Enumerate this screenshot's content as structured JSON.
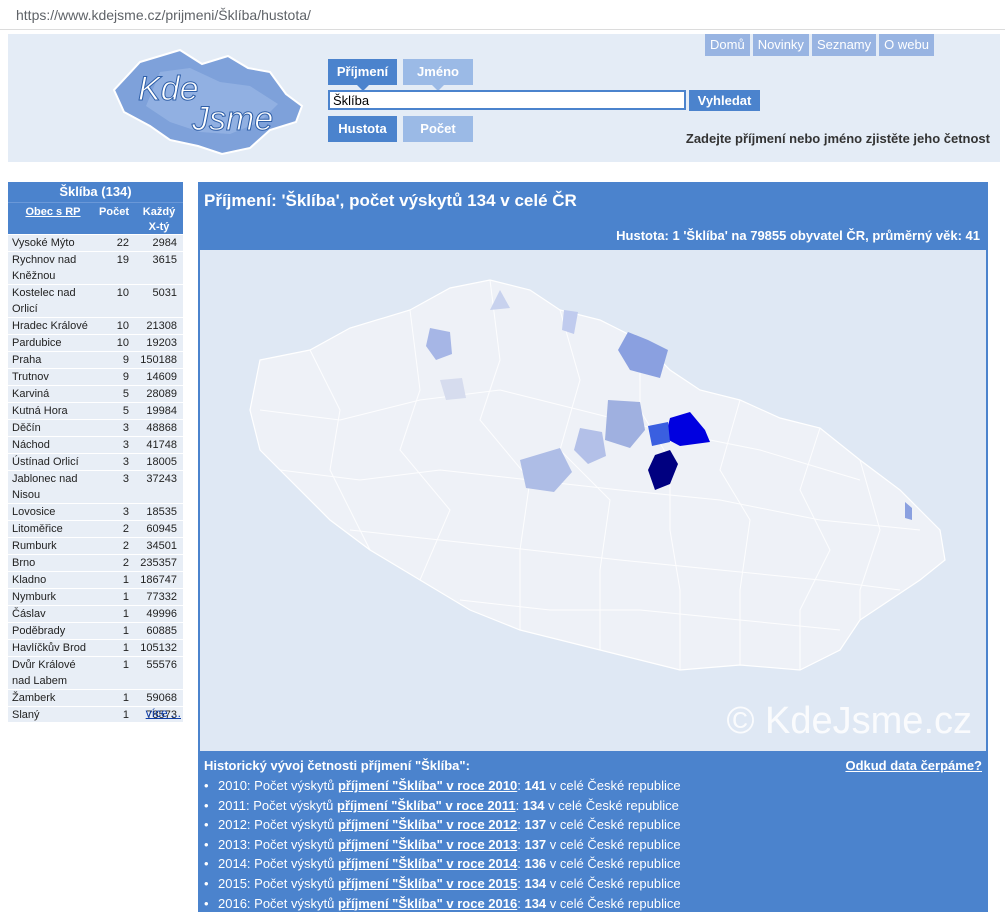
{
  "browser": {
    "url": "https://www.kdejsme.cz/prijmeni/Šklíba/hustota/"
  },
  "header": {
    "logo_text_1": "Kde",
    "logo_text_2": "Jsme",
    "nav": [
      "Domů",
      "Novinky",
      "Seznamy",
      "O webu"
    ],
    "tab_surname": "Příjmení",
    "tab_name": "Jméno",
    "tab_density": "Hustota",
    "tab_count": "Počet",
    "search_value": "Šklíba",
    "search_button": "Vyhledat",
    "hint": "Zadejte příjmení nebo jméno zjistěte jeho četnost"
  },
  "sidebar": {
    "title": "Šklíba (134)",
    "col_name": "Obec s RP",
    "col_count": "Počet",
    "col_every_1": "Každý",
    "col_every_2": "X-tý",
    "rows": [
      [
        "Vysoké Mýto",
        "22",
        "2984"
      ],
      [
        "Rychnov nad Kněžnou",
        "19",
        "3615"
      ],
      [
        "Kostelec nad Orlicí",
        "10",
        "5031"
      ],
      [
        "Hradec Králové",
        "10",
        "21308"
      ],
      [
        "Pardubice",
        "10",
        "19203"
      ],
      [
        "Praha",
        "9",
        "150188"
      ],
      [
        "Trutnov",
        "9",
        "14609"
      ],
      [
        "Karviná",
        "5",
        "28089"
      ],
      [
        "Kutná Hora",
        "5",
        "19984"
      ],
      [
        "Děčín",
        "3",
        "48868"
      ],
      [
        "Náchod",
        "3",
        "41748"
      ],
      [
        "Ústínad Orlicí",
        "3",
        "18005"
      ],
      [
        "Jablonec nad Nisou",
        "3",
        "37243"
      ],
      [
        "Lovosice",
        "3",
        "18535"
      ],
      [
        "Litoměřice",
        "2",
        "60945"
      ],
      [
        "Rumburk",
        "2",
        "34501"
      ],
      [
        "Brno",
        "2",
        "235357"
      ],
      [
        "Kladno",
        "1",
        "186747"
      ],
      [
        "Nymburk",
        "1",
        "77332"
      ],
      [
        "Čáslav",
        "1",
        "49996"
      ],
      [
        "Poděbrady",
        "1",
        "60885"
      ],
      [
        "Havlíčkův Brod",
        "1",
        "105132"
      ],
      [
        "Dvůr Králové nad Labem",
        "1",
        "55576"
      ],
      [
        "Žamberk",
        "1",
        "59068"
      ],
      [
        "Slaný",
        "1",
        "78573"
      ]
    ],
    "more": "více ..."
  },
  "main": {
    "title": "Příjmení: 'Šklíba', počet výskytů 134 v celé ČR",
    "density": "Hustota: 1 'Šklíba' na 79855 obyvatel ČR, průměrný věk: 41",
    "watermark": "© KdeJsme.cz",
    "hist_title": "Historický vývoj četnosti příjmení \"Šklíba\":",
    "hist_source": "Odkud data čerpáme?",
    "history": [
      {
        "year": "2010",
        "link": "příjmení \"Šklíba\" v roce 2010",
        "count": "141"
      },
      {
        "year": "2011",
        "link": "příjmení \"Šklíba\" v roce 2011",
        "count": "134"
      },
      {
        "year": "2012",
        "link": "příjmení \"Šklíba\" v roce 2012",
        "count": "137"
      },
      {
        "year": "2013",
        "link": "příjmení \"Šklíba\" v roce 2013",
        "count": "137"
      },
      {
        "year": "2014",
        "link": "příjmení \"Šklíba\" v roce 2014",
        "count": "136"
      },
      {
        "year": "2015",
        "link": "příjmení \"Šklíba\" v roce 2015",
        "count": "134"
      },
      {
        "year": "2016",
        "link": "příjmení \"Šklíba\" v roce 2016",
        "count": "134"
      }
    ],
    "hist_prefix": "Počet výskytů",
    "hist_suffix": "v celé České republice"
  },
  "colors": {
    "accent": "#4b83cd",
    "accent_light": "#9bbae6",
    "map_bg": "#dfe8f4",
    "map_region": "#eef1f7",
    "map_high": "#0000cc",
    "map_highest": "#000080"
  }
}
